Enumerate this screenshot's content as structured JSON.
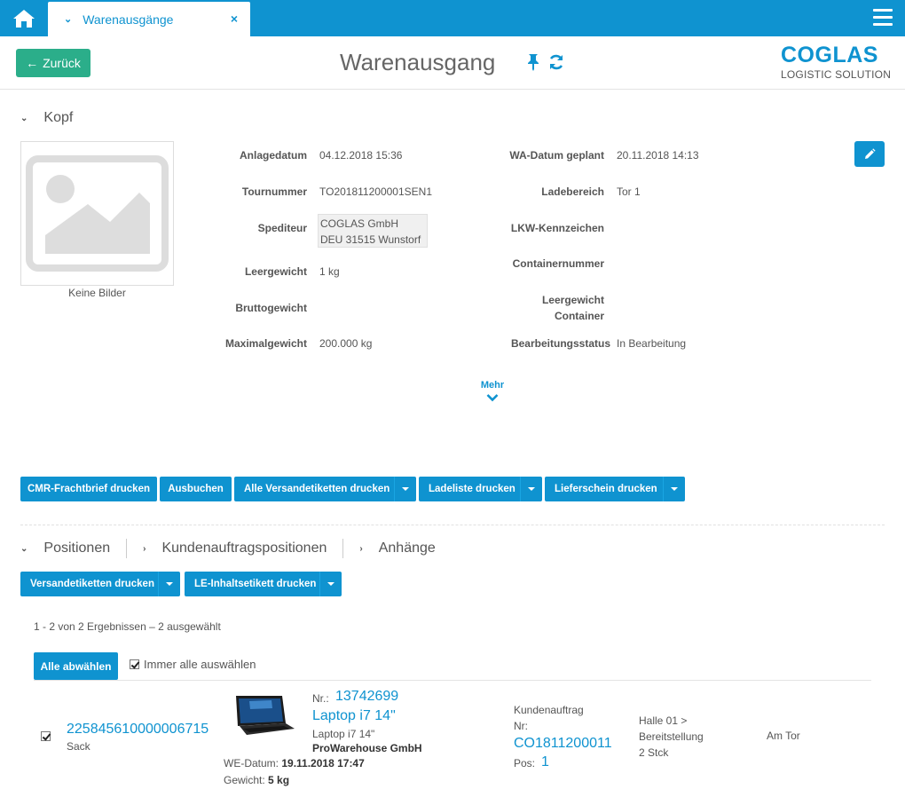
{
  "topbar": {
    "tab_label": "Warenausgänge",
    "tab_close": "×"
  },
  "header": {
    "back_label": "Zurück",
    "title": "Warenausgang",
    "logo_main": "COGLAS",
    "logo_sub": "LOGISTIC SOLUTION"
  },
  "kopf": {
    "section_label": "Kopf",
    "no_images": "Keine Bilder",
    "left_fields": [
      {
        "label": "Anlagedatum",
        "value": "04.12.2018 15:36"
      },
      {
        "label": "Tournummer",
        "value": "TO201811200001SEN1"
      },
      {
        "label": "Spediteur",
        "value_line1": "COGLAS GmbH",
        "value_line2": "DEU 31515 Wunstorf"
      },
      {
        "label": "Leergewicht",
        "value": "1 kg"
      },
      {
        "label": "Bruttogewicht",
        "value": ""
      },
      {
        "label": "Maximalgewicht",
        "value": "200.000 kg"
      }
    ],
    "right_fields": [
      {
        "label": "WA-Datum geplant",
        "value": "20.11.2018 14:13"
      },
      {
        "label": "Ladebereich",
        "value": "Tor 1"
      },
      {
        "label": "LKW-Kennzeichen",
        "value": ""
      },
      {
        "label": "Containernummer",
        "value": ""
      },
      {
        "label_line1": "Leergewicht",
        "label_line2": "Container",
        "value": ""
      },
      {
        "label": "Bearbeitungsstatus",
        "value": "In Bearbeitung"
      }
    ],
    "more_label": "Mehr"
  },
  "actions": {
    "cmr": "CMR-Frachtbrief drucken",
    "ausbuchen": "Ausbuchen",
    "versandetiketten_alle": "Alle Versandetiketten drucken",
    "ladeliste": "Ladeliste drucken",
    "lieferschein": "Lieferschein drucken"
  },
  "tabs": {
    "positionen": "Positionen",
    "kundenauftragspositionen": "Kundenauftragspositionen",
    "anhaenge": "Anhänge"
  },
  "position_actions": {
    "versandetiketten": "Versandetiketten drucken",
    "le_inhalt": "LE-Inhaltsetikett drucken"
  },
  "list": {
    "result_count": "1 - 2 von 2 Ergebnissen  –  2 ausgewählt",
    "deselect_label": "Alle abwählen",
    "select_all_label": "Immer alle auswählen"
  },
  "row": {
    "le_number": "225845610000006715",
    "le_type": "Sack",
    "nr_label": "Nr.:",
    "article_nr": "13742699",
    "article_name": "Laptop i7 14\"",
    "article_desc": "Laptop i7 14\"",
    "supplier": "ProWarehouse GmbH",
    "we_label": "WE-Datum:",
    "we_date": "19.11.2018 17:47",
    "weight_label": "Gewicht:",
    "weight": "5 kg",
    "order_label": "Kundenauftrag",
    "order_nr_label": "Nr:",
    "order_nr": "CO1811200011",
    "pos_label": "Pos:",
    "pos_value": "1",
    "location_line1": "Halle 01 >",
    "location_line2": "Bereitstellung",
    "quantity": "2 Stck",
    "status": "Am Tor"
  }
}
